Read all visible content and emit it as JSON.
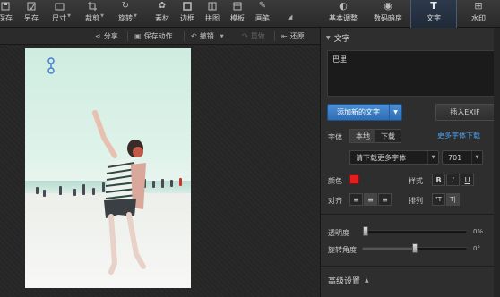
{
  "toolbar": {
    "tools": [
      {
        "label": "保存",
        "icon": "save-icon"
      },
      {
        "label": "另存",
        "icon": "save-as-icon"
      },
      {
        "label": "尺寸",
        "icon": "resize-icon"
      },
      {
        "label": "裁剪",
        "icon": "crop-icon"
      },
      {
        "label": "旋转",
        "icon": "rotate-icon"
      },
      {
        "label": "素材",
        "icon": "material-icon"
      },
      {
        "label": "边框",
        "icon": "border-icon"
      },
      {
        "label": "拼图",
        "icon": "collage-icon"
      },
      {
        "label": "模板",
        "icon": "template-icon"
      },
      {
        "label": "画笔",
        "icon": "brush-icon"
      }
    ]
  },
  "right_tabs": [
    {
      "label": "基本调整",
      "icon": "adjust-icon",
      "active": false
    },
    {
      "label": "数码暗房",
      "icon": "darkroom-icon",
      "active": false
    },
    {
      "label": "文字",
      "icon": "text-icon",
      "active": true
    },
    {
      "label": "水印",
      "icon": "watermark-icon",
      "active": false
    }
  ],
  "subbar": {
    "share": "分享",
    "save_action": "保存动作",
    "undo": "撤销",
    "redo": "重做",
    "restore": "还原"
  },
  "panel": {
    "section_title": "文字",
    "text_value": "巴里",
    "add_text_button": "添加新的文字",
    "insert_exif_button": "插入EXIF",
    "font_label": "字体",
    "local_label": "本地",
    "download_label": "下载",
    "more_fonts_link": "更多字体下载",
    "font_select": "请下载更多字体",
    "font_size": "701",
    "color_label": "颜色",
    "color_value": "#e02020",
    "style_label": "样式",
    "bold": "B",
    "italic": "I",
    "underline": "U",
    "align_label": "对齐",
    "arrange_label": "排列",
    "opacity_label": "透明度",
    "opacity_value": "0%",
    "opacity_fraction": 0.0,
    "rotate_label": "旋转角度",
    "rotate_value": "0°",
    "rotate_fraction": 0.5,
    "advanced_label": "高级设置"
  }
}
